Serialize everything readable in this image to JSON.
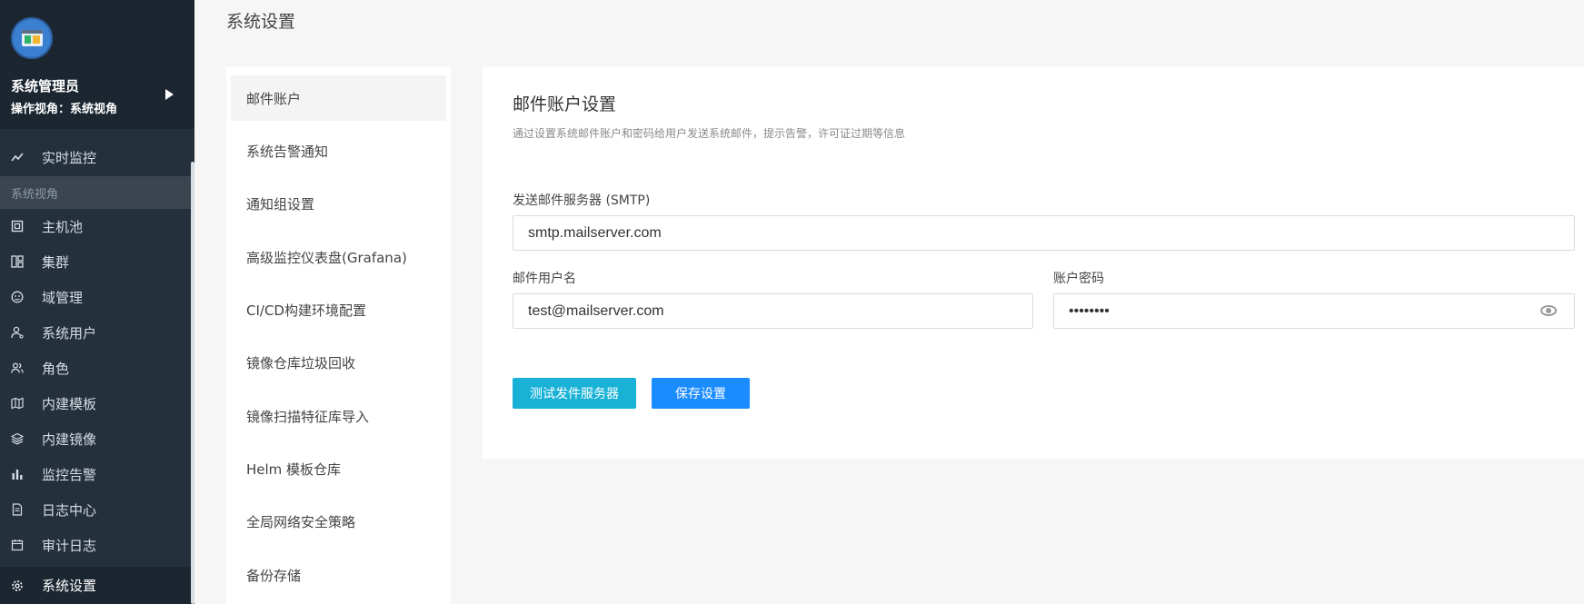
{
  "sidebar": {
    "user_name": "系统管理员",
    "user_view": "操作视角：系统视角",
    "items": [
      {
        "label": "实时监控",
        "icon": "chart-line-icon"
      },
      {
        "label": "主机池",
        "icon": "host-icon"
      },
      {
        "label": "集群",
        "icon": "cluster-icon"
      },
      {
        "label": "域管理",
        "icon": "domain-icon"
      },
      {
        "label": "系统用户",
        "icon": "user-icon"
      },
      {
        "label": "角色",
        "icon": "role-icon"
      },
      {
        "label": "内建模板",
        "icon": "template-icon"
      },
      {
        "label": "内建镜像",
        "icon": "layers-icon"
      },
      {
        "label": "监控告警",
        "icon": "bar-chart-icon"
      },
      {
        "label": "日志中心",
        "icon": "document-icon"
      },
      {
        "label": "审计日志",
        "icon": "calendar-icon"
      },
      {
        "label": "系统设置",
        "icon": "gear-icon"
      }
    ],
    "section_label": "系统视角"
  },
  "page": {
    "title": "系统设置"
  },
  "subnav": {
    "items": [
      "邮件账户",
      "系统告警通知",
      "通知组设置",
      "高级监控仪表盘(Grafana)",
      "CI/CD构建环境配置",
      "镜像仓库垃圾回收",
      "镜像扫描特征库导入",
      "Helm 模板仓库",
      "全局网络安全策略",
      "备份存储"
    ],
    "active": "邮件账户"
  },
  "form": {
    "title": "邮件账户设置",
    "description": "通过设置系统邮件账户和密码给用户发送系统邮件，提示告警，许可证过期等信息",
    "smtp_label": "发送邮件服务器 (SMTP)",
    "smtp_value": "smtp.mailserver.com",
    "username_label": "邮件用户名",
    "username_value": "test@mailserver.com",
    "password_label": "账户密码",
    "password_value": "••••••••",
    "test_button": "测试发件服务器",
    "save_button": "保存设置"
  },
  "colors": {
    "sidebar_bg": "#24303c",
    "test_button": "#19b2d6",
    "save_button": "#1a8cff"
  }
}
